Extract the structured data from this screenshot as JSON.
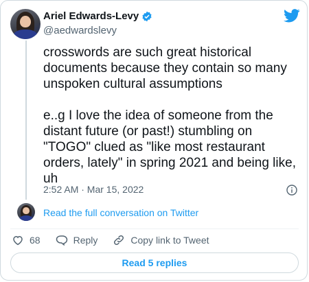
{
  "author": {
    "name": "Ariel Edwards-Levy",
    "handle": "@aedwardslevy",
    "verified_icon": "verified-badge-icon"
  },
  "brand": {
    "icon": "twitter-bird-icon",
    "color": "#1d9bf0"
  },
  "tweet": {
    "text": "crosswords are such great historical documents because they contain so many unspoken cultural assumptions\n\ne..g I love the idea of someone from the distant future (or past!) stumbling on \"TOGO\" clued as \"like most restaurant orders, lately\" in spring 2021 and being like, uh",
    "timestamp": "2:52 AM · Mar 15, 2022"
  },
  "conversation": {
    "link_label": "Read the full conversation on Twitter"
  },
  "actions": {
    "like_count": "68",
    "reply_label": "Reply",
    "copy_link_label": "Copy link to Tweet"
  },
  "replies_button": {
    "label": "Read 5 replies"
  }
}
